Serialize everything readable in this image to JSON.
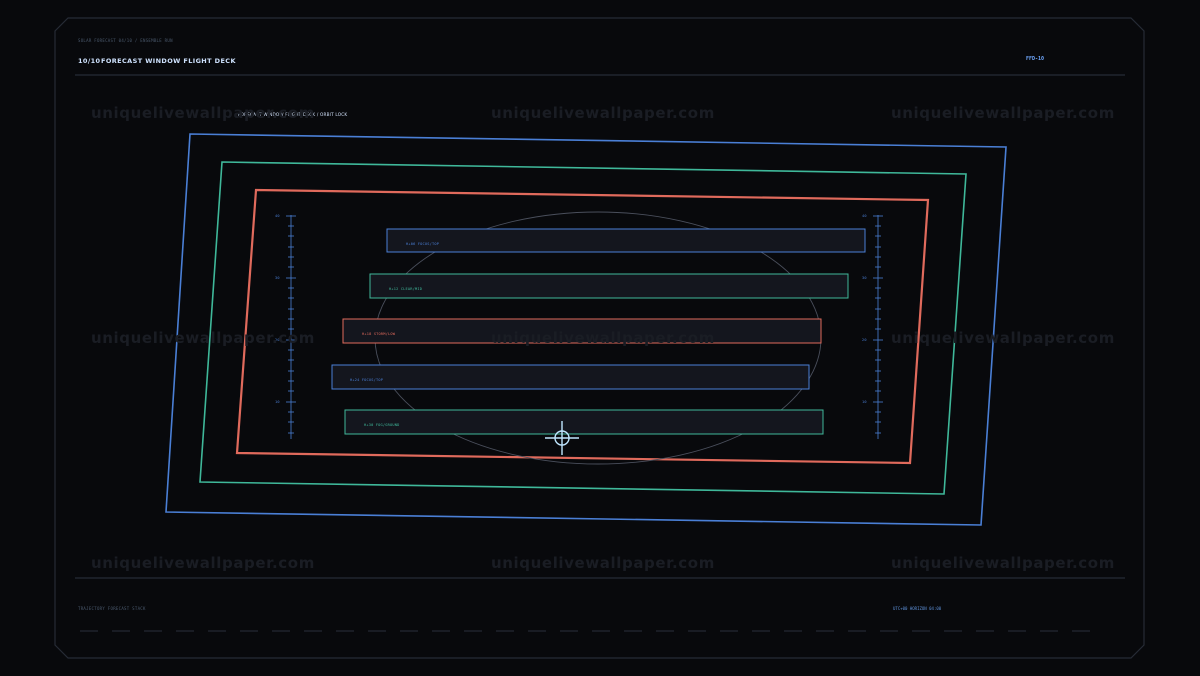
{
  "header": {
    "subtitle": "SOLAR FORECAST 04/10 / ENSEMBLE RUN",
    "index": "10/10",
    "title": "FORECAST WINDOW FLIGHT DECK",
    "code": "FFD-10"
  },
  "deck": {
    "label": "FORECAST WINDOW FLIGHT DECK / ORBIT LOCK"
  },
  "bands": [
    {
      "label": "H+06 FOCUS/TOP",
      "color": "#4a7fd6"
    },
    {
      "label": "H+12 CLEAR/MID",
      "color": "#3fb89a"
    },
    {
      "label": "H+18 STORM/LOW",
      "color": "#e06a5c"
    },
    {
      "label": "H+24 FOCUS/TOP",
      "color": "#4a7fd6"
    },
    {
      "label": "H+30 FOG/GROUND",
      "color": "#3fb89a"
    }
  ],
  "scale_left": {
    "labels": [
      "40",
      "30",
      "20",
      "10"
    ]
  },
  "scale_right": {
    "labels": [
      "40",
      "30",
      "20",
      "10"
    ]
  },
  "footer": {
    "left": "TRAJECTORY FORECAST STACK",
    "right": "UTC+00 HORIZON 04:00"
  },
  "watermark": "uniquelivewallpaper.com",
  "colors": {
    "blue": "#4a7fd6",
    "green": "#3fb89a",
    "red": "#e06a5c",
    "background": "#08090c"
  }
}
